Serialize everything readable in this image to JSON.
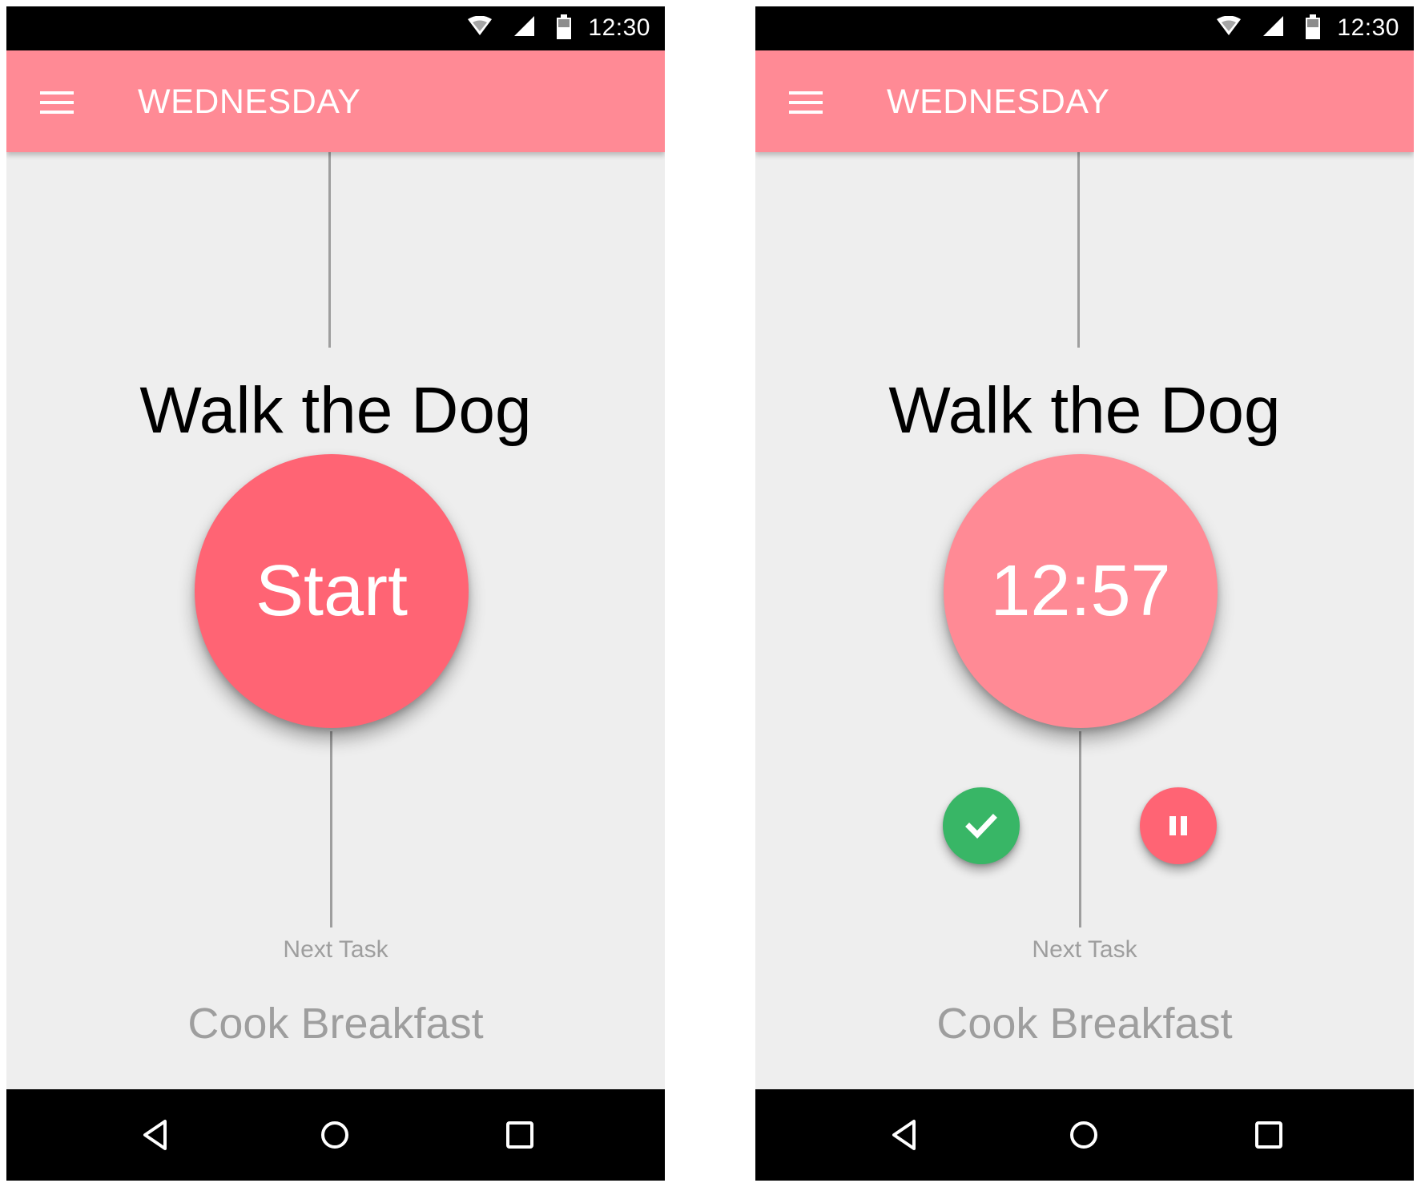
{
  "screens": [
    {
      "status_bar": {
        "time": "12:30"
      },
      "app_bar": {
        "title": "WEDNESDAY"
      },
      "task": {
        "title": "Walk the Dog"
      },
      "primary_action": {
        "label": "Start"
      },
      "next": {
        "label": "Next Task",
        "task": "Cook Breakfast"
      }
    },
    {
      "status_bar": {
        "time": "12:30"
      },
      "app_bar": {
        "title": "WEDNESDAY"
      },
      "task": {
        "title": "Walk the Dog"
      },
      "timer": {
        "value": "12:57"
      },
      "next": {
        "label": "Next Task",
        "task": "Cook Breakfast"
      }
    }
  ],
  "icons": {
    "menu": "menu-icon",
    "wifi": "wifi-icon",
    "signal": "signal-icon",
    "battery": "battery-icon",
    "complete": "checkmark-icon",
    "pause": "pause-icon",
    "back": "back-triangle-icon",
    "home": "home-circle-icon",
    "recents": "recents-square-icon"
  },
  "colors": {
    "app_bar": "#ff8a95",
    "start_button": "#ff6474",
    "timer_circle": "#ff8a95",
    "complete_button": "#38b666",
    "pause_button": "#ff6474",
    "background": "#eeeeee",
    "secondary_text": "#9e9e9e"
  }
}
